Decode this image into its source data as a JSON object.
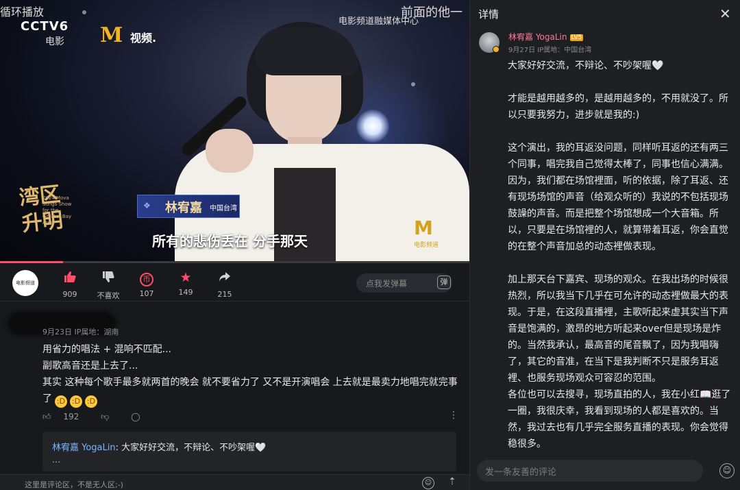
{
  "video": {
    "loop_label": "循环播放",
    "cctv_label": "CCTV6",
    "cctv_sub": "电影",
    "m_logo": "M",
    "m_label": "视频.",
    "media_center": "电影频道融媒体中心",
    "before_text": "前面的他一",
    "show_title": "湾区升明",
    "show_title_sub": "2024 Mova Songs Show for the Greater Bay Area",
    "nameplate_name": "林宥嘉",
    "nameplate_region": "中国台湾",
    "subtitle": "所有的悲伤丢在 分手那天",
    "watermark": "M",
    "watermark_label": "电影频道",
    "progress_fraction": 0.135
  },
  "actions": {
    "channel_avatar_label": "电影频道",
    "like": {
      "icon": "thumbs-up-icon",
      "count": "909"
    },
    "dislike": {
      "icon": "thumbs-down-icon",
      "label": "不喜欢"
    },
    "coin": {
      "icon": "coin-icon",
      "glyph": "币",
      "count": "107"
    },
    "favorite": {
      "icon": "star-icon",
      "count": "149"
    },
    "share": {
      "icon": "share-icon",
      "count": "215"
    },
    "danmu_placeholder": "点我发弹幕",
    "danmu_button": "弹"
  },
  "comment": {
    "meta": "9月23日 IP属地：湖南",
    "lines": [
      "用省力的唱法 + 混响不匹配...",
      "副歌高音还是上去了...",
      "其实 这种每个歌手最多就两首的晚会 就不要省力了 又不是开演唱会 上去就是最卖力地唱完就完事了"
    ],
    "emoji": "😆",
    "likes": "192",
    "reply": {
      "author": "林宥嘉 YogaLin",
      "text": ": 大家好好交流，不辩论、不吵架喔🤍",
      "ellipsis": "..."
    }
  },
  "bottom": {
    "placeholder": "这里是评论区，不是无人区;-)"
  },
  "details": {
    "title": "详情",
    "author": "林宥嘉 YogaLin",
    "level": "LV5",
    "meta": "9月27日  IP属地：中国台湾",
    "paragraphs": [
      "大家好好交流，不辩论、不吵架喔🤍",
      "才能是越用越多的，是越用越多的，不用就没了。所以只要我努力，进步就是我的:)",
      "这个演出，我的耳返没问题，同样听耳返的还有两三个同事，唱完我自己觉得太棒了，同事也信心满满。因为，我们都在场馆裡面，听的依据，除了耳返、还有现场场馆的声音（给观众听的）我说的不包括现场鼓譟的声音。而是把整个场馆想成一个大音箱。所以，只要是在场馆裡的人，就算带着耳返，你会直觉的在整个声音加总的动态裡做表现。",
      "加上那天台下嘉宾、现场的观众。在我出场的时候很热烈，所以我当下几乎在可允许的动态裡做最大的表现。于是，在这段直播裡，主歌听起来虚其实当下声音是饱满的，激昂的地方听起来over但是现场是炸的。当然我承认，最高音的尾音飘了，因为我唱嗨了，其它的音准，在当下是我判断不只是服务耳返裡、也服务现场观众可容忍的范围。",
      "各位也可以去搜寻，现场直拍的人，我在小红📖逛了一圈，我很庆幸，我看到现场的人都是喜欢的。当然，我过去也有几乎完全服务直播的表现。你会觉得稳很多。"
    ],
    "input_placeholder": "发一条友善的评论",
    "close_icon": "close-icon"
  },
  "colors": {
    "bg": "#18191c",
    "panel_bg": "#1e1f22",
    "author_pink": "#ff7a94",
    "reply_blue": "#7ab4ff",
    "like_pink": "#ff4d6a",
    "progress": "#ff4d6a"
  }
}
